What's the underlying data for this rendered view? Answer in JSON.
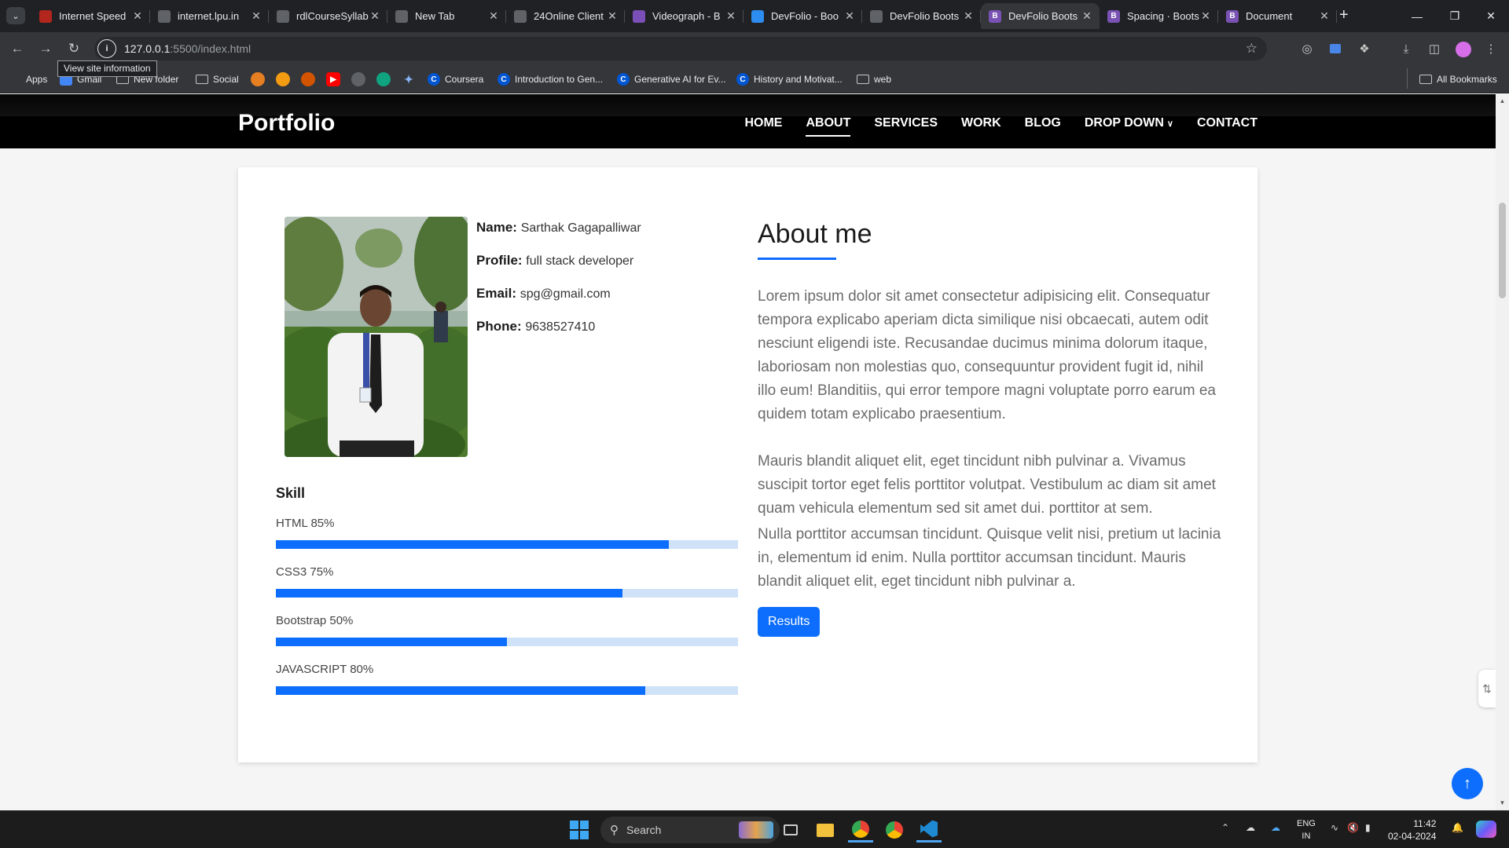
{
  "browser": {
    "tabs": [
      {
        "title": "Internet Speed",
        "color": "#b3261e",
        "glyph": ""
      },
      {
        "title": "internet.lpu.in",
        "color": "#5f6368",
        "glyph": ""
      },
      {
        "title": "rdlCourseSyllab",
        "color": "#5f6368",
        "glyph": ""
      },
      {
        "title": "New Tab",
        "color": "#5f6368",
        "glyph": ""
      },
      {
        "title": "24Online Client",
        "color": "#5f6368",
        "glyph": ""
      },
      {
        "title": "Videograph - B",
        "color": "#7b4fb8",
        "glyph": ""
      },
      {
        "title": "DevFolio - Boo",
        "color": "#2d8cf0",
        "glyph": ""
      },
      {
        "title": "DevFolio Boots",
        "color": "#5f6368",
        "glyph": ""
      },
      {
        "title": "DevFolio Boots",
        "color": "#7952b3",
        "glyph": "B"
      },
      {
        "title": "Spacing · Boots",
        "color": "#7952b3",
        "glyph": "B"
      },
      {
        "title": "Document",
        "color": "#7952b3",
        "glyph": "B"
      }
    ],
    "active_tab_index": 8,
    "url_host": "127.0.0.1",
    "url_path": ":5500/index.html",
    "tooltip": "View site information",
    "bookmarks": {
      "apps": "Apps",
      "gmail": "Gmail",
      "new_folder": "New folder",
      "social": "Social",
      "coursera": "Coursera",
      "intro_gen": "Introduction to Gen...",
      "gen_ai": "Generative AI for Ev...",
      "history": "History and Motivat...",
      "web": "web",
      "all": "All Bookmarks"
    }
  },
  "site": {
    "brand": "Portfolio",
    "nav": [
      {
        "label": "HOME",
        "active": false
      },
      {
        "label": "ABOUT",
        "active": true
      },
      {
        "label": "SERVICES",
        "active": false
      },
      {
        "label": "WORK",
        "active": false
      },
      {
        "label": "BLOG",
        "active": false
      },
      {
        "label": "DROP DOWN",
        "active": false,
        "dropdown": true
      },
      {
        "label": "CONTACT",
        "active": false
      }
    ],
    "profile": {
      "name_label": "Name:",
      "name": "Sarthak Gagapalliwar",
      "profile_label": "Profile:",
      "profile": "full stack developer",
      "email_label": "Email:",
      "email": "spg@gmail.com",
      "phone_label": "Phone:",
      "phone": "9638527410"
    },
    "skills_title": "Skill",
    "skills": [
      {
        "label": "HTML 85%",
        "percent": 85
      },
      {
        "label": "CSS3 75%",
        "percent": 75
      },
      {
        "label": "Bootstrap 50%",
        "percent": 50
      },
      {
        "label": "JAVASCRIPT 80%",
        "percent": 80
      }
    ],
    "about_title": "About me",
    "about_paragraphs": [
      "Lorem ipsum dolor sit amet consectetur adipisicing elit. Consequatur tempora explicabo aperiam dicta similique nisi obcaecati, autem odit nesciunt eligendi iste. Recusandae ducimus minima dolorum itaque, laboriosam non molestias quo, consequuntur provident fugit id, nihil illo eum! Blanditiis, qui error tempore magni voluptate porro earum ea quidem totam explicabo praesentium.",
      "Mauris blandit aliquet elit, eget tincidunt nibh pulvinar a. Vivamus suscipit tortor eget felis porttitor volutpat. Vestibulum ac diam sit amet quam vehicula elementum sed sit amet dui. porttitor at sem.",
      "Nulla porttitor accumsan tincidunt. Quisque velit nisi, pretium ut lacinia in, elementum id enim. Nulla porttitor accumsan tincidunt. Mauris blandit aliquet elit, eget tincidunt nibh pulvinar a."
    ],
    "results_button": "Results",
    "accent_color": "#0d6efd"
  },
  "taskbar": {
    "search_placeholder": "Search",
    "lang_line1": "ENG",
    "lang_line2": "IN",
    "time": "11:42",
    "date": "02-04-2024"
  }
}
